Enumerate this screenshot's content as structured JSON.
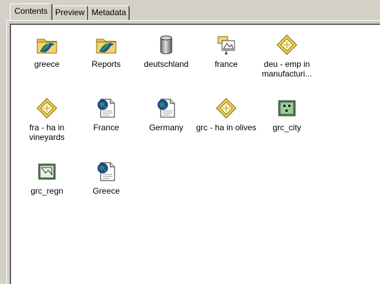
{
  "tabs": [
    {
      "label": "Contents",
      "active": true
    },
    {
      "label": "Preview",
      "active": false
    },
    {
      "label": "Metadata",
      "active": false
    }
  ],
  "items": [
    {
      "label": "greece",
      "icon": "folder-globe-icon"
    },
    {
      "label": "Reports",
      "icon": "folder-globe-icon"
    },
    {
      "label": "deutschland",
      "icon": "database-icon"
    },
    {
      "label": "france",
      "icon": "coverage-icon"
    },
    {
      "label": "deu - emp in manufacturi...",
      "icon": "layer-file-icon"
    },
    {
      "label": "fra - ha in vineyards",
      "icon": "layer-file-icon"
    },
    {
      "label": "France",
      "icon": "map-document-icon"
    },
    {
      "label": "Germany",
      "icon": "map-document-icon"
    },
    {
      "label": "grc - ha in olives",
      "icon": "layer-file-icon"
    },
    {
      "label": "grc_city",
      "icon": "point-shapefile-icon"
    },
    {
      "label": "grc_regn",
      "icon": "polygon-shapefile-icon"
    },
    {
      "label": "Greece",
      "icon": "map-document-icon"
    }
  ],
  "colors": {
    "folder": "#e8c44c",
    "map_green": "#2e8b57",
    "map_blue": "#1e4fa0",
    "layer_yellow": "#f5d94a",
    "shapefile_green": "#8fbc8f",
    "window_face": "#d4d0c8"
  }
}
